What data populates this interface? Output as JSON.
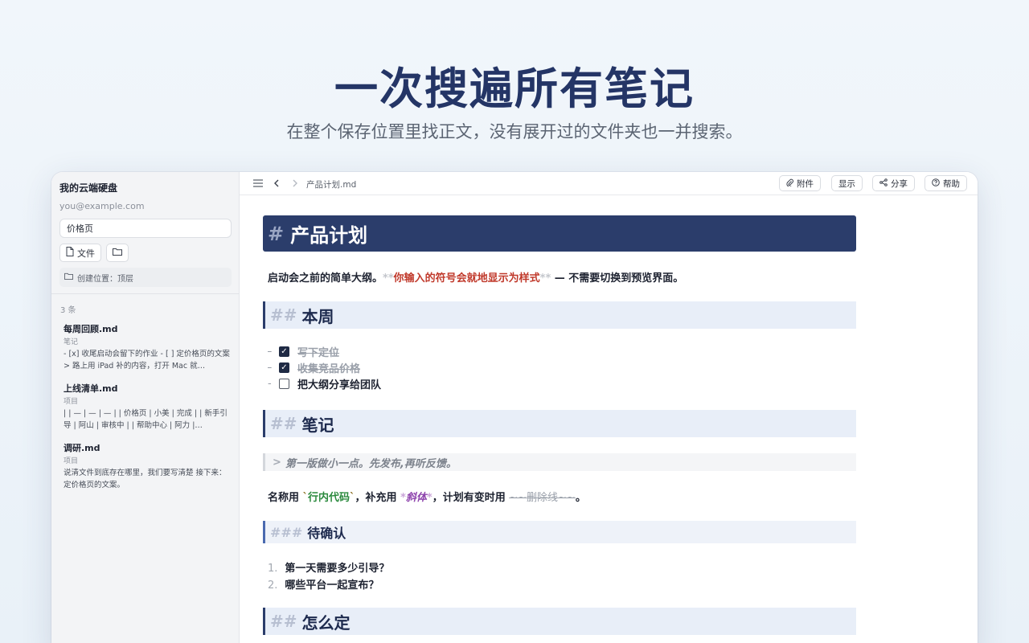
{
  "hero": {
    "title": "一次搜遍所有笔记",
    "subtitle": "在整个保存位置里找正文，没有展开过的文件夹也一并搜索。"
  },
  "sidebar": {
    "title": "我的云端硬盘",
    "email": "you@example.com",
    "search_value": "价格页",
    "file_button": "文件",
    "scope": "创建位置：顶层",
    "count": "3 条",
    "results": [
      {
        "title": "每周回顾.md",
        "type": "笔记",
        "snippet": "- [x] 收尾启动会留下的作业 - [ ] 定价格页的文案 > 路上用 iPad 补的内容，打开 Mac 就…"
      },
      {
        "title": "上线清单.md",
        "type": "项目",
        "snippet": "| | — | — | — | | 价格页 | 小美 | 完成 | | 新手引导 | 阿山 | 审核中 | | 帮助中心 | 阿力 |…"
      },
      {
        "title": "调研.md",
        "type": "项目",
        "snippet": "说清文件到底存在哪里，我们要写清楚 接下来：定价格页的文案。"
      }
    ]
  },
  "toolbar": {
    "filename": "产品计划.md",
    "attach": "附件",
    "display": "显示",
    "share": "分享",
    "help": "帮助"
  },
  "doc": {
    "h1_mark": "#",
    "h1": "产品计划",
    "intro_prefix": "启动会之前的简单大纲。",
    "intro_mark": "**",
    "intro_bold": "你输入的符号会就地显示为样式",
    "intro_suffix": " — 不需要切换到预览界面。",
    "h2_mark": "##",
    "h2_week": "本周",
    "task_dash": "-",
    "tasks": [
      {
        "label": "写下定位",
        "done": true
      },
      {
        "label": "收集竞品价格",
        "done": true
      },
      {
        "label": "把大纲分享给团队",
        "done": false
      }
    ],
    "h2_notes": "笔记",
    "quote_mark": ">",
    "quote": "第一版做小一点。先发布,再听反馈。",
    "inline_a": "名称用 ",
    "code_tick": "`",
    "code": "行内代码",
    "inline_b": "，补充用 ",
    "em_mark": "*",
    "em": "斜体",
    "inline_c": "，计划有变时用 ",
    "strike": "~~删除线~~",
    "inline_d": "。",
    "h3_mark": "###",
    "h3": "待确认",
    "list": [
      {
        "num": "1.",
        "text": "第一天需要多少引导？"
      },
      {
        "num": "2.",
        "text": "哪些平台一起宣布？"
      }
    ],
    "h2_decide": "怎么定"
  }
}
